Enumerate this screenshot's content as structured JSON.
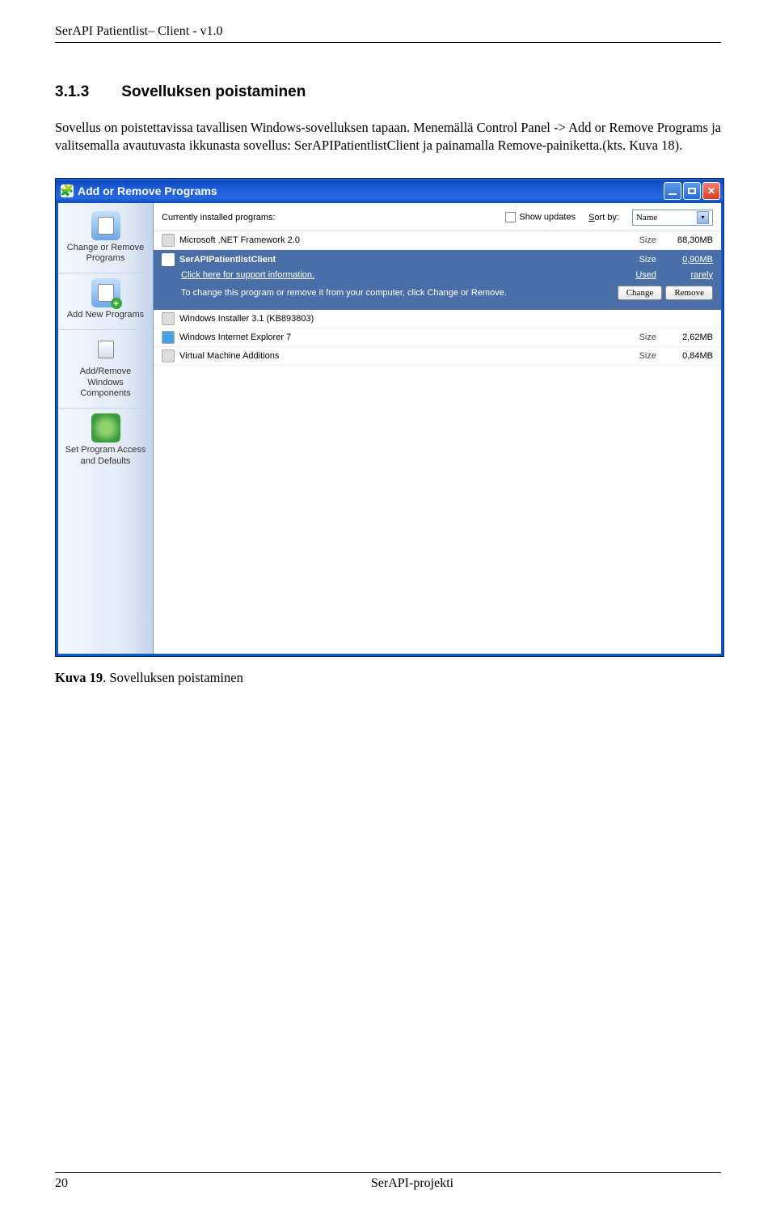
{
  "doc": {
    "header": "SerAPI Patientlist– Client -  v1.0",
    "section_number": "3.1.3",
    "section_title": "Sovelluksen poistaminen",
    "paragraph": "Sovellus on poistettavissa tavallisen Windows-sovelluksen tapaan. Menemällä Control Panel -> Add or Remove Programs ja valitsemalla avautuvasta ikkunasta sovellus: SerAPIPatientlistClient ja painamalla Remove-painiketta.(kts. Kuva 18).",
    "caption_label": "Kuva 19",
    "caption_text": ". Sovelluksen poistaminen",
    "footer_page": "20",
    "footer_text": "SerAPI-projekti"
  },
  "win": {
    "title": "Add or Remove Programs",
    "sidebar": [
      "Change or Remove Programs",
      "Add New Programs",
      "Add/Remove Windows Components",
      "Set Program Access and Defaults"
    ],
    "toolbar": {
      "installed_label": "Currently installed programs:",
      "show_updates": "Show updates",
      "sort_by_label": "Sort by:",
      "sort_by_value": "Name"
    },
    "rows": {
      "net": {
        "name": "Microsoft .NET Framework 2.0",
        "size_label": "Size",
        "size": "88,30MB"
      },
      "selected": {
        "name": "SerAPIPatientlistClient",
        "size_label": "Size",
        "size": "0,90MB",
        "support": "Click here for support information.",
        "used_label": "Used",
        "used": "rarely",
        "desc": "To change this program or remove it from your computer, click Change or Remove.",
        "change_btn": "Change",
        "remove_btn": "Remove"
      },
      "wi": {
        "name": "Windows Installer 3.1 (KB893803)"
      },
      "ie": {
        "name": "Windows Internet Explorer 7",
        "size_label": "Size",
        "size": "2,62MB"
      },
      "vm": {
        "name": "Virtual Machine Additions",
        "size_label": "Size",
        "size": "0,84MB"
      }
    }
  }
}
